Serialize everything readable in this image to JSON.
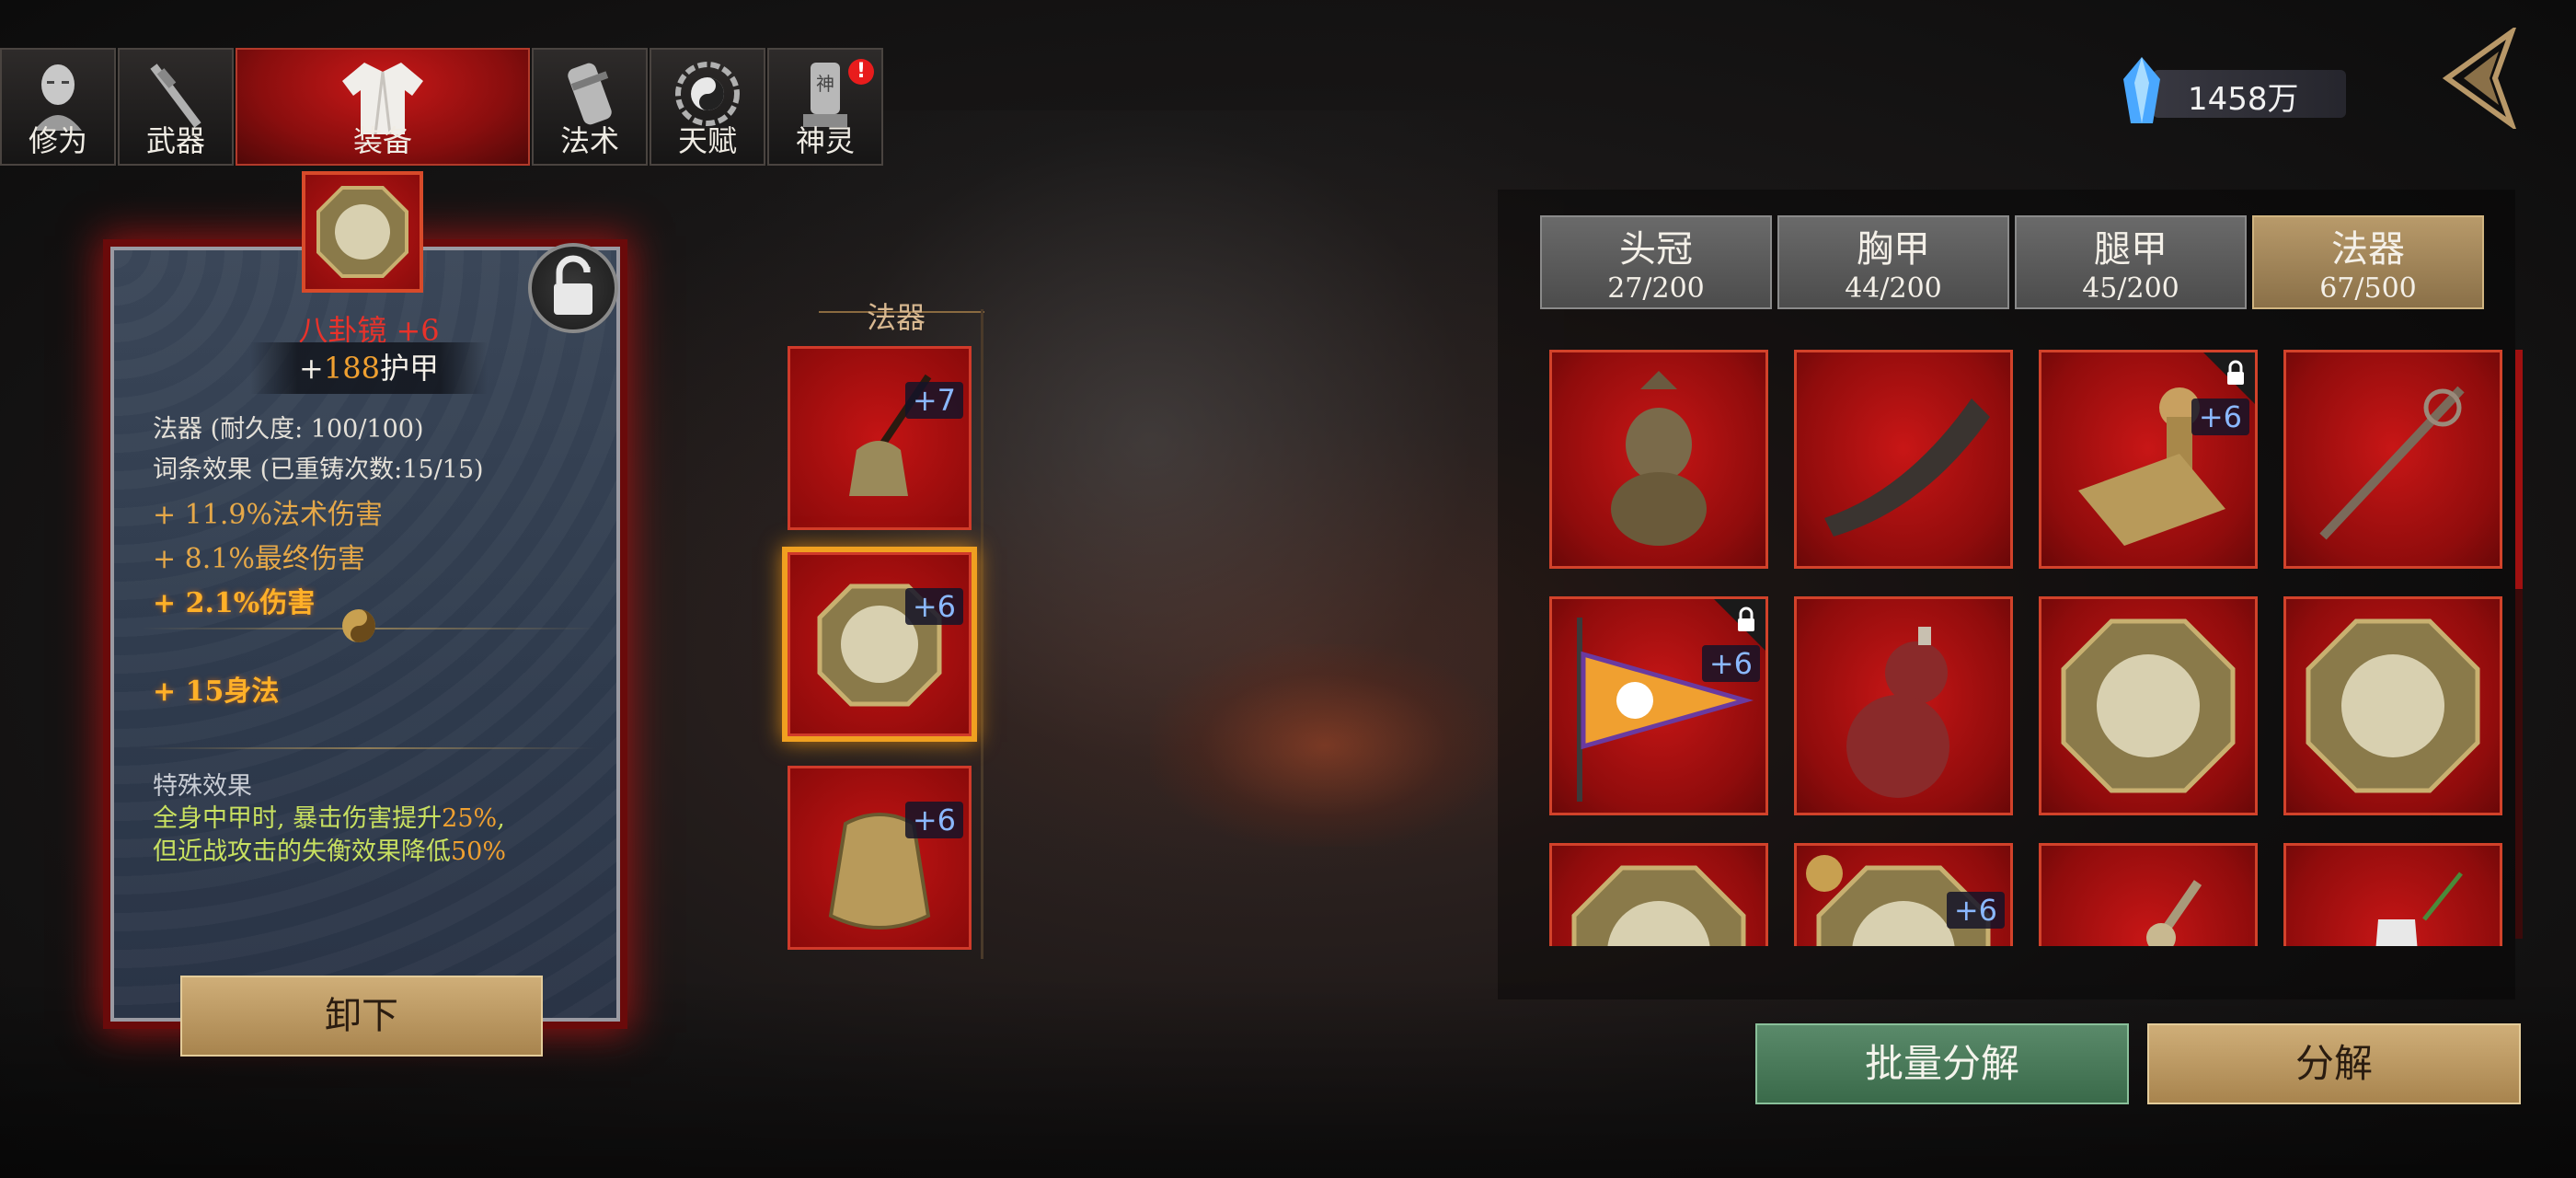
{
  "tabs": [
    {
      "label": "修为",
      "icon": "head-icon"
    },
    {
      "label": "武器",
      "icon": "sword-icon"
    },
    {
      "label": "装备",
      "icon": "armor-icon",
      "active": true
    },
    {
      "label": "法术",
      "icon": "scroll-icon"
    },
    {
      "label": "天赋",
      "icon": "bagua-icon"
    },
    {
      "label": "神灵",
      "icon": "shrine-icon",
      "alert": "!",
      "badge_text": "神"
    }
  ],
  "currency": {
    "amount": "1458万",
    "icon": "crystal-icon"
  },
  "detail": {
    "item_name": "八卦镜 +6",
    "armor_prefix": "+",
    "armor_value": "188",
    "armor_suffix": "护甲",
    "type_line": "法器 (耐久度: 100/100)",
    "affix_line": "词条效果 (已重铸次数:15/15)",
    "stats": [
      "+ 11.9%法术伤害",
      "+ 8.1%最终伤害",
      "+ 2.1%伤害",
      "+ 15身法"
    ],
    "special_title": "特殊效果",
    "special_text_1a": "全身中甲时, 暴击伤害提升",
    "special_text_1b": "25%",
    "special_text_1c": ",",
    "special_text_2a": "但近战攻击的失衡效果降低",
    "special_text_2b": "50%",
    "unequip_label": "卸下"
  },
  "slot_column": {
    "header": "法器",
    "slots": [
      {
        "item": "bell-pendant",
        "plus": "+7"
      },
      {
        "item": "bagua-mirror",
        "plus": "+6",
        "selected": true
      },
      {
        "item": "golden-pouch",
        "plus": "+6"
      }
    ]
  },
  "categories": [
    {
      "name": "头冠",
      "count": "27/200"
    },
    {
      "name": "胸甲",
      "count": "44/200"
    },
    {
      "name": "腿甲",
      "count": "45/200"
    },
    {
      "name": "法器",
      "count": "67/500",
      "active": true
    }
  ],
  "inventory": [
    {
      "item": "bronze-censer",
      "plus": ""
    },
    {
      "item": "horn",
      "plus": ""
    },
    {
      "item": "seal-stamp",
      "plus": "+6",
      "locked": true
    },
    {
      "item": "ornate-staff",
      "plus": ""
    },
    {
      "item": "bagua-banner",
      "plus": "+6",
      "locked": true
    },
    {
      "item": "gourd",
      "plus": ""
    },
    {
      "item": "bagua-mirror",
      "plus": ""
    },
    {
      "item": "bagua-mirror",
      "plus": ""
    },
    {
      "item": "bagua-mirror",
      "plus": ""
    },
    {
      "item": "bagua-mirror",
      "plus": "+6"
    },
    {
      "item": "vajra",
      "plus": ""
    },
    {
      "item": "vase-bamboo",
      "plus": ""
    }
  ],
  "buttons": {
    "batch_decompose": "批量分解",
    "decompose": "分解"
  },
  "colors": {
    "accent_red": "#c41414",
    "gold": "#f0a030",
    "panel_blue": "#2e3a4c",
    "special_green": "#c8e060",
    "plus_blue": "#8ab8ff"
  }
}
